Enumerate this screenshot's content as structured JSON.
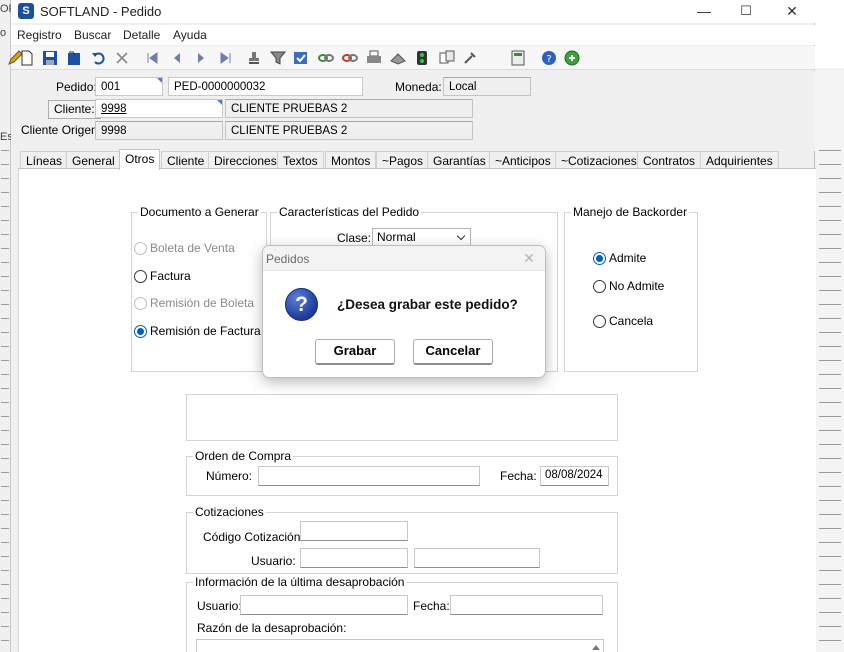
{
  "background": {
    "frag_top": "OF",
    "frag_mid": "o",
    "frag_low": "Es"
  },
  "window": {
    "title": "SOFTLAND - Pedido",
    "min_glyph": "—",
    "max_glyph": "☐",
    "close_glyph": "✕"
  },
  "menu": [
    "Registro",
    "Buscar",
    "Detalle",
    "Ayuda"
  ],
  "header": {
    "pedido_label": "Pedido:",
    "pedido_code": "001",
    "pedido_number": "PED-0000000032",
    "moneda_label": "Moneda:",
    "moneda_value": "Local",
    "cliente_button": "Cliente:",
    "cliente_code": "9998",
    "cliente_name": "CLIENTE PRUEBAS 2",
    "cliente_origen_label": "Cliente Origen:",
    "cliente_origen_code": "9998",
    "cliente_origen_name": "CLIENTE PRUEBAS 2"
  },
  "tabs": [
    "Líneas",
    "General",
    "Otros",
    "Cliente",
    "Direcciones",
    "Textos",
    "Montos",
    "~Pagos",
    "Garantías",
    "~Anticipos",
    "~Cotizaciones",
    "Contratos",
    "Adquirientes"
  ],
  "active_tab": "Otros",
  "documento": {
    "title": "Documento a Generar",
    "options": [
      "Boleta de Venta",
      "Factura",
      "Remisión de Boleta",
      "Remisión de Factura"
    ],
    "selected": "Remisión de Factura"
  },
  "caracteristicas": {
    "title": "Características del Pedido",
    "clase_label": "Clase:",
    "clase_value": "Normal"
  },
  "backorder": {
    "title": "Manejo de Backorder",
    "options": [
      "Admite",
      "No Admite",
      "Cancela"
    ],
    "selected": "Admite"
  },
  "orden_compra": {
    "title": "Orden de Compra",
    "numero_label": "Número:",
    "numero_value": "",
    "fecha_label": "Fecha:",
    "fecha_value": "08/08/2024"
  },
  "cotizaciones": {
    "title": "Cotizaciones",
    "codigo_label": "Código Cotización:",
    "usuario_label": "Usuario:"
  },
  "desaprobacion": {
    "title": "Información de la última desaprobación",
    "usuario_label": "Usuario:",
    "fecha_label": "Fecha:",
    "razon_label": "Razón de la desaprobación:"
  },
  "dialog": {
    "title": "Pedidos",
    "close_glyph": "✕",
    "icon_glyph": "?",
    "message": "¿Desea grabar este pedido?",
    "confirm": "Grabar",
    "cancel": "Cancelar"
  },
  "colors": {
    "accent": "#005fb8",
    "dialog_icon": "#1d3a9a",
    "app_icon": "#1b4fa0"
  }
}
